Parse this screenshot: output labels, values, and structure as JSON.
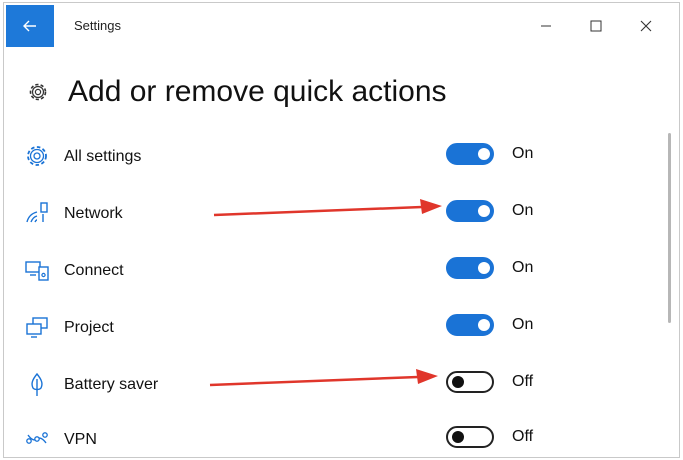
{
  "window": {
    "title": "Settings",
    "controls": [
      "minimize-icon",
      "maximize-icon",
      "close-icon"
    ]
  },
  "page": {
    "title": "Add or remove quick actions",
    "icon": "gear-icon"
  },
  "items": [
    {
      "label": "All settings",
      "icon": "gear-icon",
      "state": "On",
      "on": true
    },
    {
      "label": "Network",
      "icon": "network-icon",
      "state": "On",
      "on": true
    },
    {
      "label": "Connect",
      "icon": "connect-icon",
      "state": "On",
      "on": true
    },
    {
      "label": "Project",
      "icon": "project-icon",
      "state": "On",
      "on": true
    },
    {
      "label": "Battery saver",
      "icon": "battery-saver-icon",
      "state": "Off",
      "on": false
    },
    {
      "label": "VPN",
      "icon": "vpn-icon",
      "state": "Off",
      "on": false
    }
  ],
  "colors": {
    "accent": "#1a73d6",
    "annotation_arrow": "#e0362b"
  }
}
